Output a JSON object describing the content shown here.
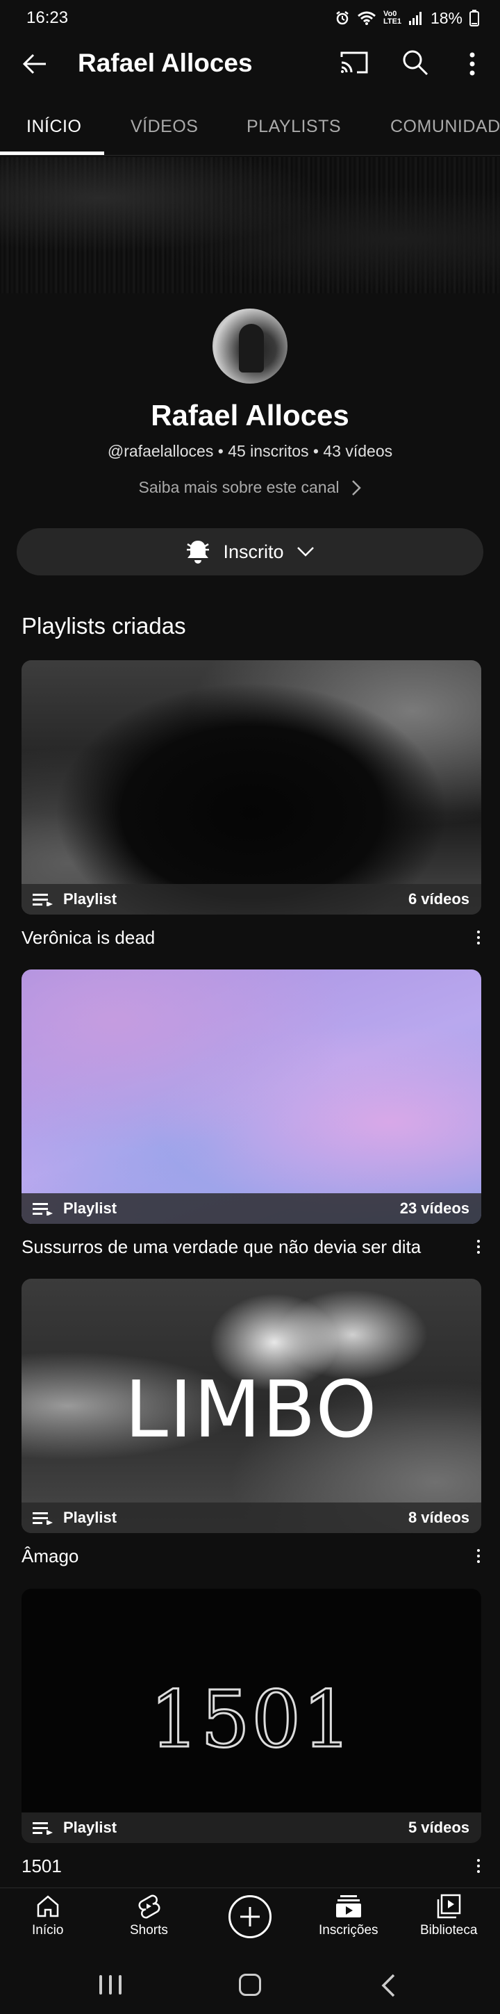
{
  "status_bar": {
    "time": "16:23",
    "network": "Vo0 LTE1",
    "battery": "18%"
  },
  "header": {
    "title": "Rafael Alloces"
  },
  "tabs": [
    {
      "label": "INÍCIO",
      "active": true
    },
    {
      "label": "VÍDEOS",
      "active": false
    },
    {
      "label": "PLAYLISTS",
      "active": false
    },
    {
      "label": "COMUNIDADE",
      "active": false
    }
  ],
  "channel": {
    "name": "Rafael Alloces",
    "handle": "@rafaelalloces",
    "subscribers": "45 inscritos",
    "videos": "43 vídeos",
    "separator": "•",
    "about_link": "Saiba mais sobre este canal",
    "subscribe_label": "Inscrito"
  },
  "section": {
    "title": "Playlists criadas"
  },
  "playlists": [
    {
      "title": "Verônica is dead",
      "badge": "Playlist",
      "count": "6 vídeos"
    },
    {
      "title": "Sussurros de uma verdade que não devia ser dita",
      "badge": "Playlist",
      "count": "23 vídeos"
    },
    {
      "title": "Âmago",
      "badge": "Playlist",
      "count": "8 vídeos",
      "thumb_text": "LIMBO"
    },
    {
      "title": "1501",
      "badge": "Playlist",
      "count": "5 vídeos",
      "thumb_text": "1501"
    }
  ],
  "bottom_nav": {
    "home": "Início",
    "shorts": "Shorts",
    "subscriptions": "Inscrições",
    "library": "Biblioteca"
  },
  "icons": {
    "back": "arrow-left-icon",
    "cast": "cast-icon",
    "search": "search-icon",
    "more": "more-vertical-icon",
    "bell": "bell-icon",
    "chevron": "chevron-down-icon",
    "playlist": "playlist-icon"
  },
  "colors": {
    "background": "#0f0f0f",
    "surface": "#272727",
    "text_primary": "#f1f1f1",
    "text_secondary": "#aaaaaa"
  }
}
